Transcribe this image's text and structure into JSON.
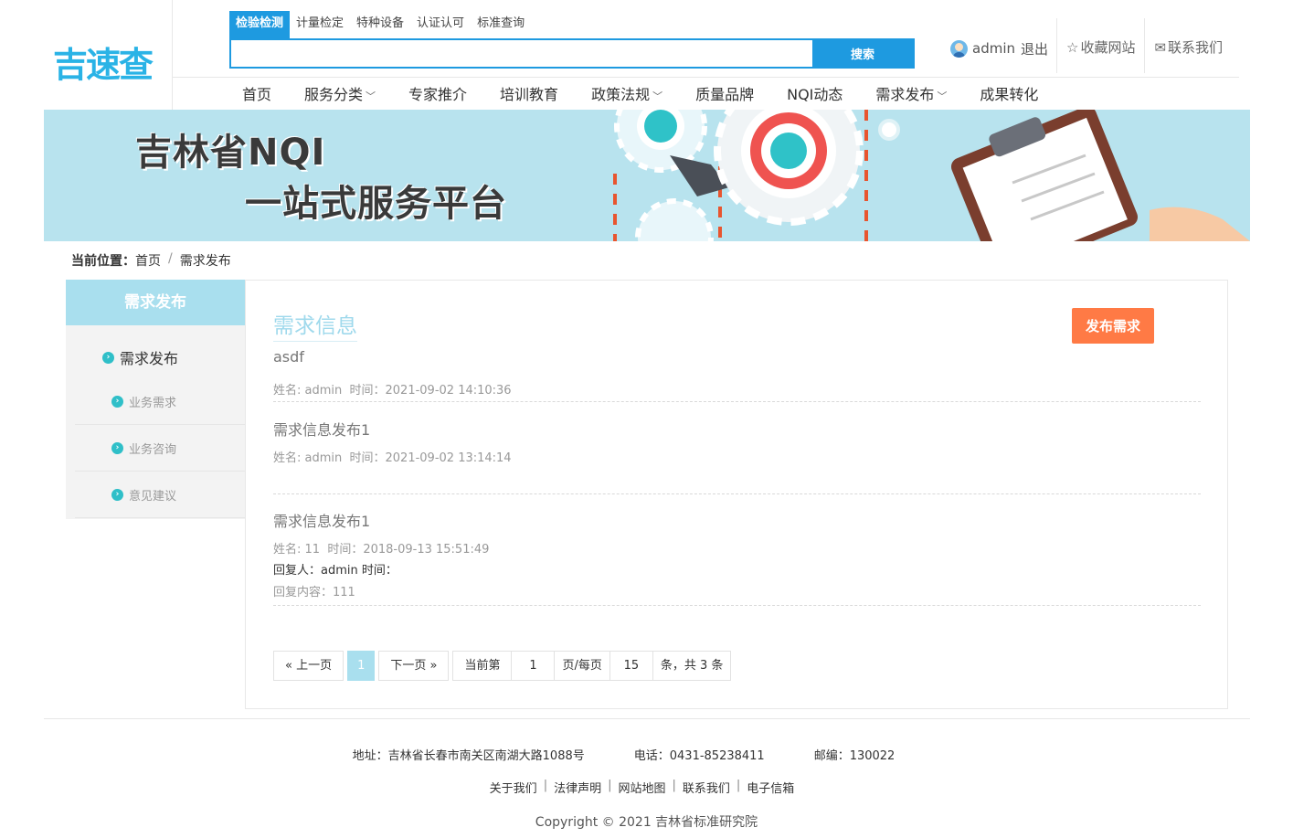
{
  "logo": "吉速查",
  "search": {
    "tabs": [
      "检验检测",
      "计量检定",
      "特种设备",
      "认证认可",
      "标准查询"
    ],
    "placeholder": "",
    "button": "搜索"
  },
  "user": {
    "name": "admin",
    "logout": "退出"
  },
  "top_links": {
    "favorite": "收藏网站",
    "contact": "联系我们"
  },
  "nav": [
    "首页",
    "服务分类",
    "专家推介",
    "培训教育",
    "政策法规",
    "质量品牌",
    "NQI动态",
    "需求发布",
    "成果转化"
  ],
  "banner": {
    "line1": "吉林省NQI",
    "line2": "一站式服务平台"
  },
  "breadcrumb": {
    "label": "当前位置：",
    "home": "首页",
    "sep": "/",
    "current": "需求发布"
  },
  "sidebar": {
    "title": "需求发布",
    "main": "需求发布",
    "items": [
      "业务需求",
      "业务咨询",
      "意见建议"
    ]
  },
  "main": {
    "title": "需求信息",
    "publish_button": "发布需求",
    "entries": [
      {
        "title": "asdf",
        "meta": "姓名: admin  时间：2021-09-02 14:10:36"
      },
      {
        "title": "需求信息发布1",
        "meta": "姓名: admin  时间：2021-09-02 13:14:14"
      },
      {
        "title": "需求信息发布1",
        "meta": "姓名: 11  时间：2018-09-13 15:51:49",
        "reply": "回复人：admin 时间：",
        "reply_content": "回复内容：111"
      }
    ]
  },
  "pager": {
    "prev": "« 上一页",
    "current": "1",
    "next": "下一页 »",
    "current_label": "当前第",
    "page_value": "1",
    "per_page_label": "页/每页",
    "per_page_value": "15",
    "total": "条，共 3 条"
  },
  "footer": {
    "address": "地址：吉林省长春市南关区南湖大路1088号",
    "phone": "电话：0431-85238411",
    "postcode": "邮编：130022",
    "links": [
      "关于我们",
      "法律声明",
      "网站地图",
      "联系我们",
      "电子信箱"
    ],
    "copyright": "Copyright © 2021 吉林省标准研究院"
  },
  "colors": {
    "primary": "#1e9ae0",
    "accent": "#a9dfee",
    "publish": "#ff7a45",
    "banner": "#b8e3ee"
  }
}
